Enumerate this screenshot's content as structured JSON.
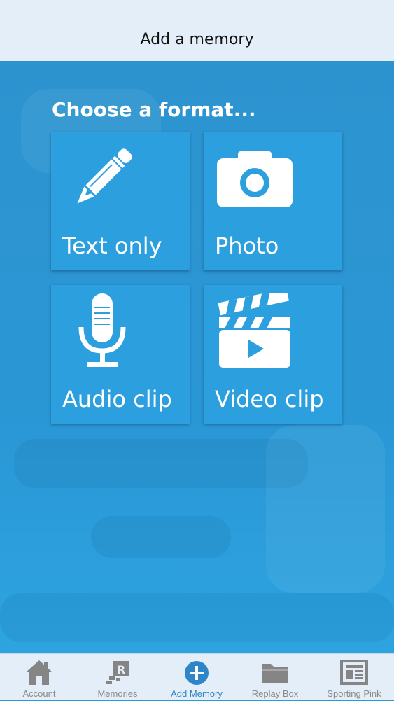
{
  "header": {
    "title": "Add a memory"
  },
  "main": {
    "heading": "Choose a format...",
    "formats": [
      {
        "label": "Text only",
        "icon": "pencil-icon"
      },
      {
        "label": "Photo",
        "icon": "camera-icon"
      },
      {
        "label": "Audio clip",
        "icon": "microphone-icon"
      },
      {
        "label": "Video clip",
        "icon": "clapperboard-icon"
      }
    ]
  },
  "tabbar": {
    "active_index": 2,
    "items": [
      {
        "label": "Account",
        "icon": "home-icon"
      },
      {
        "label": "Memories",
        "icon": "memories-icon"
      },
      {
        "label": "Add Memory",
        "icon": "add-circle-icon"
      },
      {
        "label": "Replay Box",
        "icon": "folder-icon"
      },
      {
        "label": "Sporting Pink",
        "icon": "newspaper-icon"
      }
    ]
  },
  "colors": {
    "background": "#2a9ad9",
    "tile": "#2c9fdf",
    "header": "#e3eef8",
    "active_tab": "#2e86c9",
    "inactive_tab": "#8a8a8a"
  }
}
